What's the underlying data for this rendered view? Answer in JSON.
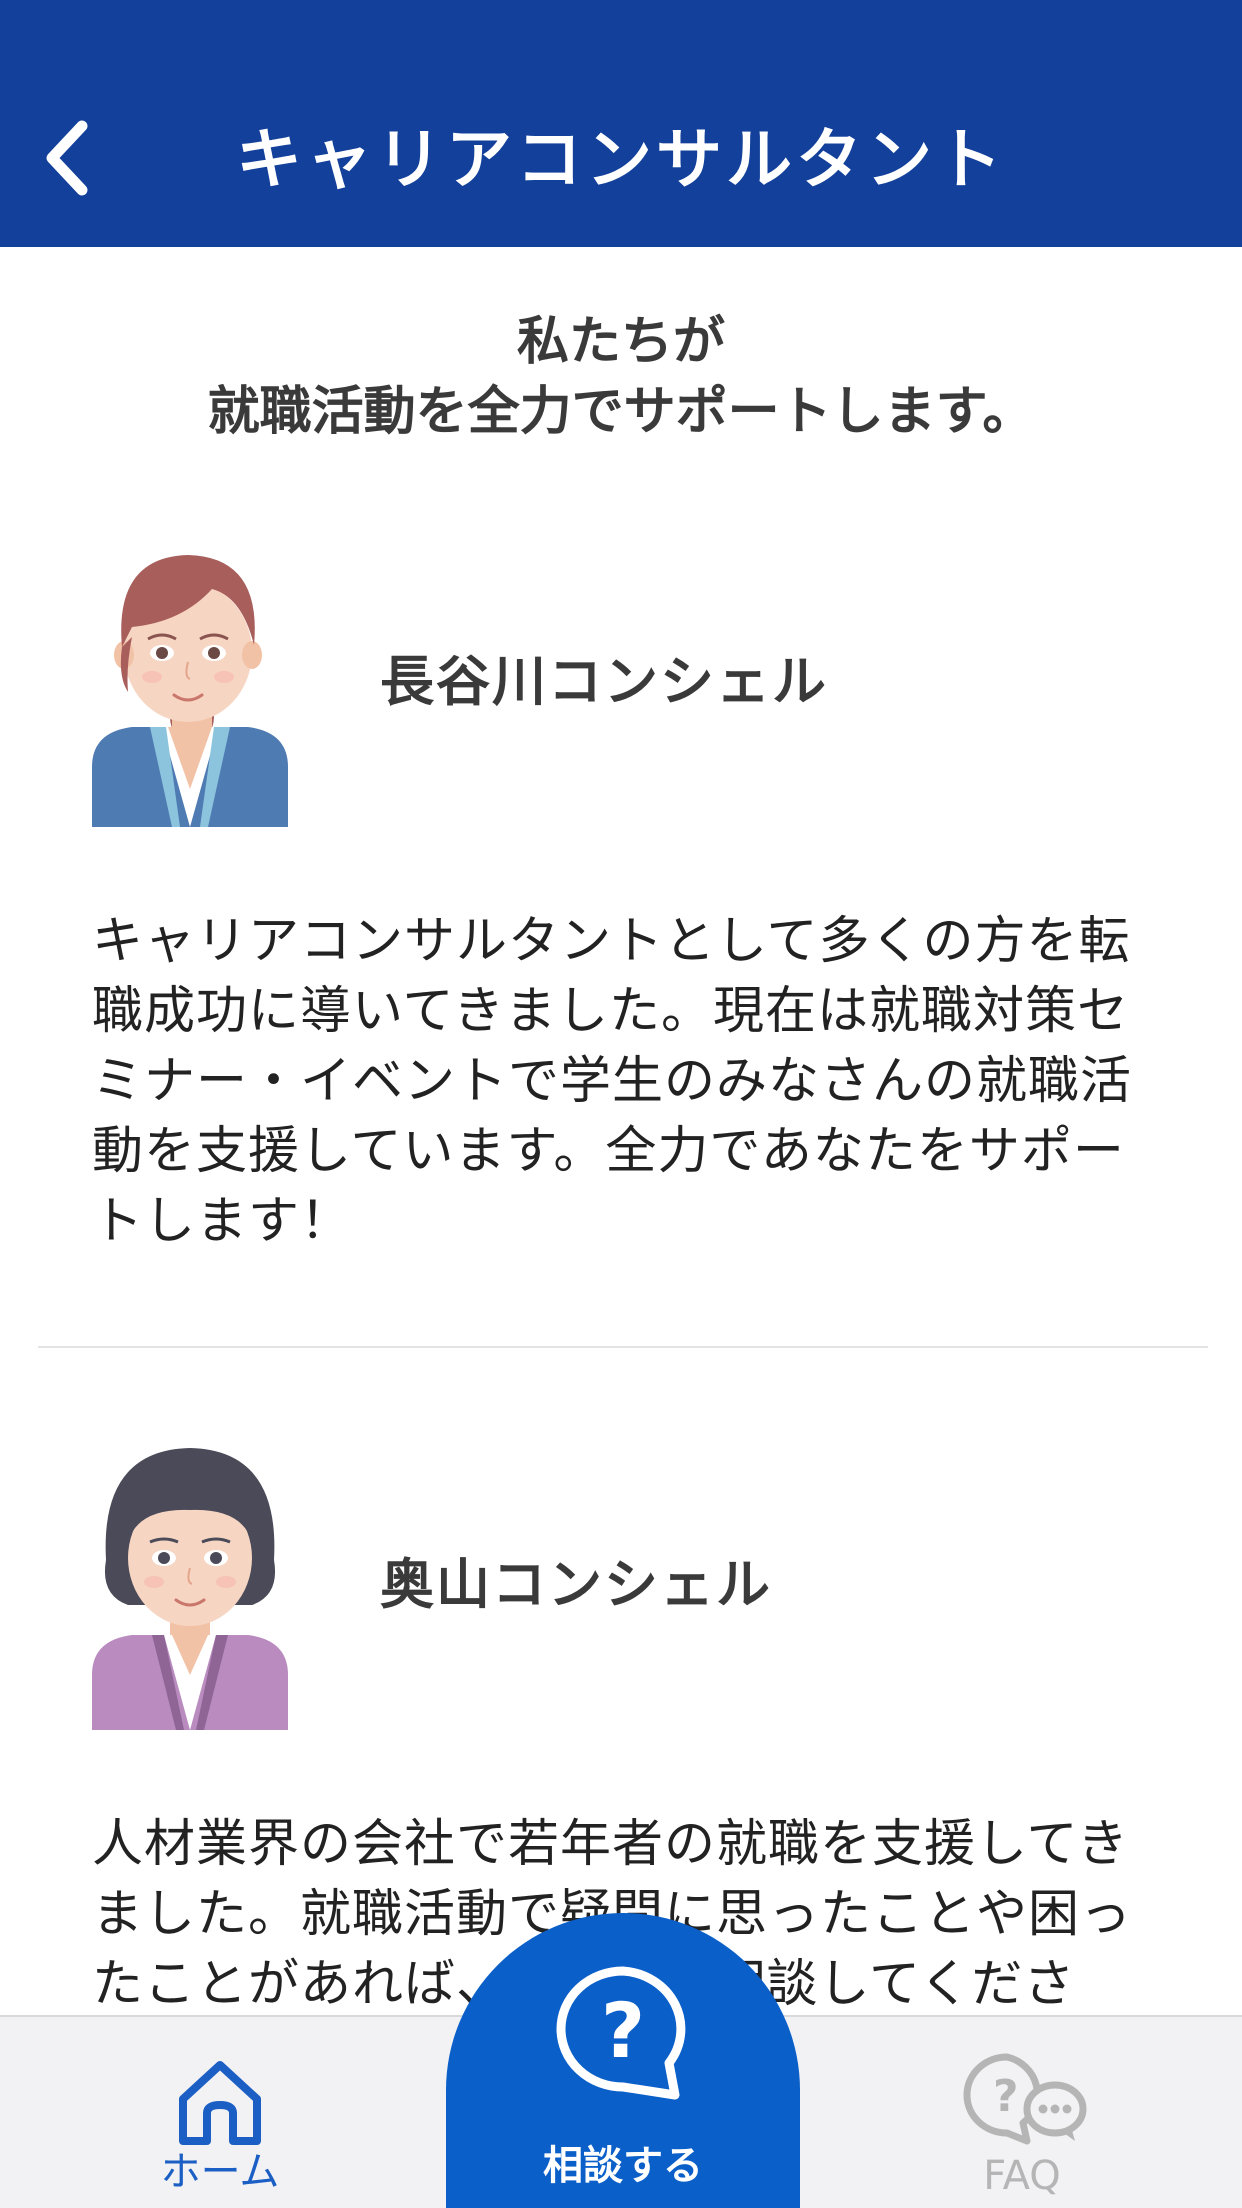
{
  "header": {
    "title": "キャリアコンサルタント",
    "back_icon": "chevron-left-icon",
    "background_color": "#12409a"
  },
  "intro": {
    "line1": "私たちが",
    "line2": "就職活動を全力でサポートします。"
  },
  "consultants": [
    {
      "name": "長谷川コンシェル",
      "bio": "キャリアコンサルタントとして多くの方を転職成功に導いてきました。現在は就職対策セミナー・イベントで学生のみなさんの就職活動を支援しています。全力であなたをサポートします！",
      "avatar_icon": "consultant-avatar-icon"
    },
    {
      "name": "奥山コンシェル",
      "bio": "人材業界の会社で若年者の就職を支援してきました。就職活動で疑問に思ったことや困ったことがあれば、どんどん相談してください。",
      "avatar_icon": "consultant-avatar-icon"
    }
  ],
  "tabbar": {
    "home_label": "ホーム",
    "consult_label": "相談する",
    "faq_label": "FAQ",
    "home_icon": "home-icon",
    "consult_icon": "question-bubble-icon",
    "faq_icon": "faq-chat-icon",
    "active_color": "#1c5fc4",
    "consult_color": "#0b5fc9"
  }
}
